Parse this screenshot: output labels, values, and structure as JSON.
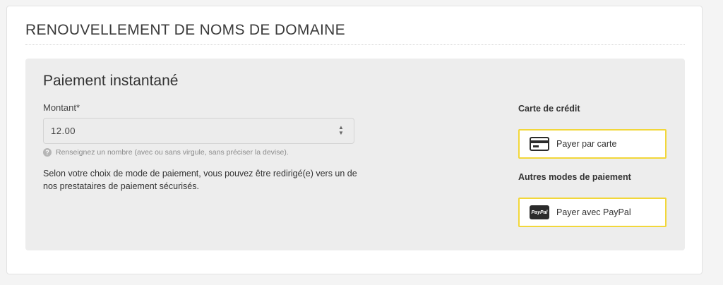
{
  "page": {
    "title": "RENOUVELLEMENT DE NOMS DE DOMAINE"
  },
  "payment": {
    "heading": "Paiement instantané",
    "amount_label": "Montant*",
    "amount_value": "12.00",
    "hint": "Renseignez un nombre (avec ou sans virgule, sans préciser la devise).",
    "redirect_text": "Selon votre choix de mode de paiement, vous pouvez être redirigé(e) vers un de nos prestataires de paiement sécurisés."
  },
  "credit_card": {
    "section_label": "Carte de crédit",
    "button_label": "Payer par carte",
    "icon": "credit-card-icon"
  },
  "other_methods": {
    "section_label": "Autres modes de paiement",
    "button_label": "Payer avec PayPal",
    "icon": "paypal-icon",
    "icon_text": "PayPal"
  },
  "colors": {
    "accent_border": "#f2d73a",
    "panel_bg": "#ededed"
  }
}
